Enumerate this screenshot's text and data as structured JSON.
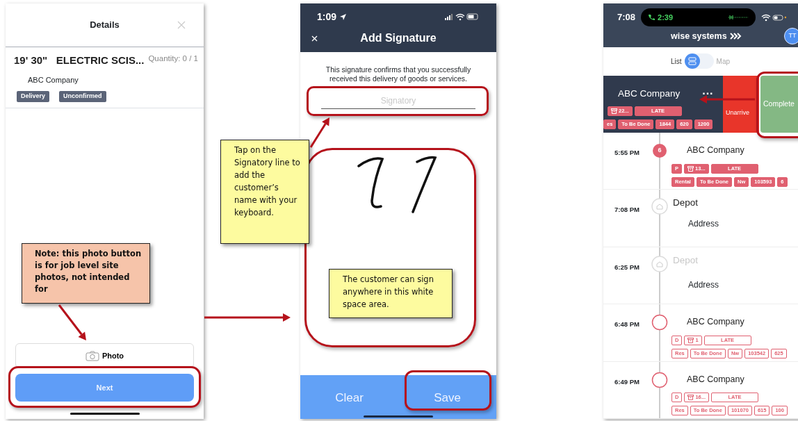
{
  "details_screen": {
    "title": "Details",
    "item": {
      "name": "19' 30\"   ELECTRIC SCIS...",
      "quantity": "Quantity: 0 / 1",
      "customer": "ABC Company",
      "tags": [
        "Delivery",
        "Unconfirmed"
      ]
    },
    "photo_button": "Photo",
    "next_button": "Next"
  },
  "signature_screen": {
    "time": "1:09",
    "title": "Add Signature",
    "message": "This signature confirms that you successfully received this delivery of goods or services.",
    "signatory": {
      "placeholder": "Signatory"
    },
    "buttons": [
      "Clear",
      "Save"
    ]
  },
  "route_screen": {
    "time": "7:08",
    "call_time": "2:39",
    "brand": "wise systems",
    "avatar": "TT",
    "view_options": [
      {
        "label": "List",
        "selected": true
      },
      {
        "label": "Map",
        "selected": false
      }
    ],
    "swiped_stop": {
      "name": "ABC Company",
      "menu": "···",
      "tag_rows": [
        [
          {
            "text": "22...",
            "kind": "box"
          },
          {
            "text": "LATE",
            "kind": "wide"
          }
        ],
        [
          {
            "text": "es",
            "kind": "plain"
          },
          {
            "text": "To Be Done",
            "kind": "plain"
          },
          {
            "text": "1844",
            "kind": "plain"
          },
          {
            "text": "620",
            "kind": "plain"
          },
          {
            "text": "1200",
            "kind": "plain"
          }
        ]
      ],
      "actions": [
        "Unarrive",
        "Complete"
      ]
    },
    "stops": [
      {
        "time": "5:55 PM",
        "kind": "current",
        "faded": false,
        "marker": "6",
        "name": "ABC Company",
        "tag_rows": [
          [
            {
              "text": "P",
              "kind": "plain"
            },
            {
              "text": "13...",
              "kind": "box"
            },
            {
              "text": "LATE",
              "kind": "wide"
            }
          ],
          [
            {
              "text": "Rental",
              "kind": "plain"
            },
            {
              "text": "To Be Done",
              "kind": "plain"
            },
            {
              "text": "Nw",
              "kind": "plain"
            },
            {
              "text": "103593",
              "kind": "plain"
            },
            {
              "text": "6",
              "kind": "plain"
            }
          ]
        ]
      },
      {
        "time": "7:08 PM",
        "kind": "depot",
        "faded": false,
        "name": "Depot",
        "address": "Address"
      },
      {
        "time": "6:25 PM",
        "kind": "depot",
        "faded": true,
        "name": "Depot",
        "address": "Address"
      },
      {
        "time": "6:48 PM",
        "kind": "pending",
        "faded": false,
        "name": "ABC Company",
        "tag_rows": [
          [
            {
              "text": "D",
              "kind": "plain"
            },
            {
              "text": "1",
              "kind": "box"
            },
            {
              "text": "LATE",
              "kind": "wide"
            }
          ],
          [
            {
              "text": "Res",
              "kind": "plain"
            },
            {
              "text": "To Be Done",
              "kind": "plain"
            },
            {
              "text": "Nw",
              "kind": "plain"
            },
            {
              "text": "103542",
              "kind": "plain"
            },
            {
              "text": "625",
              "kind": "plain"
            }
          ]
        ]
      },
      {
        "time": "6:49 PM",
        "kind": "pending",
        "faded": false,
        "name": "ABC Company",
        "tag_rows": [
          [
            {
              "text": "D",
              "kind": "plain"
            },
            {
              "text": "16...",
              "kind": "box"
            },
            {
              "text": "LATE",
              "kind": "wide"
            }
          ],
          [
            {
              "text": "Res",
              "kind": "plain"
            },
            {
              "text": "To Be Done",
              "kind": "plain"
            },
            {
              "text": "101070",
              "kind": "plain"
            },
            {
              "text": "615",
              "kind": "plain"
            },
            {
              "text": "100",
              "kind": "plain"
            }
          ]
        ]
      }
    ]
  },
  "callouts": [
    {
      "kind": "note",
      "text": "Note: this photo button is for job level site photos, not intended for"
    },
    {
      "kind": "tip",
      "text": "Tap on the Signatory line to add the customer’s name with your keyboard."
    },
    {
      "kind": "tip",
      "text": "The customer can sign anywhere in this white space area."
    }
  ]
}
